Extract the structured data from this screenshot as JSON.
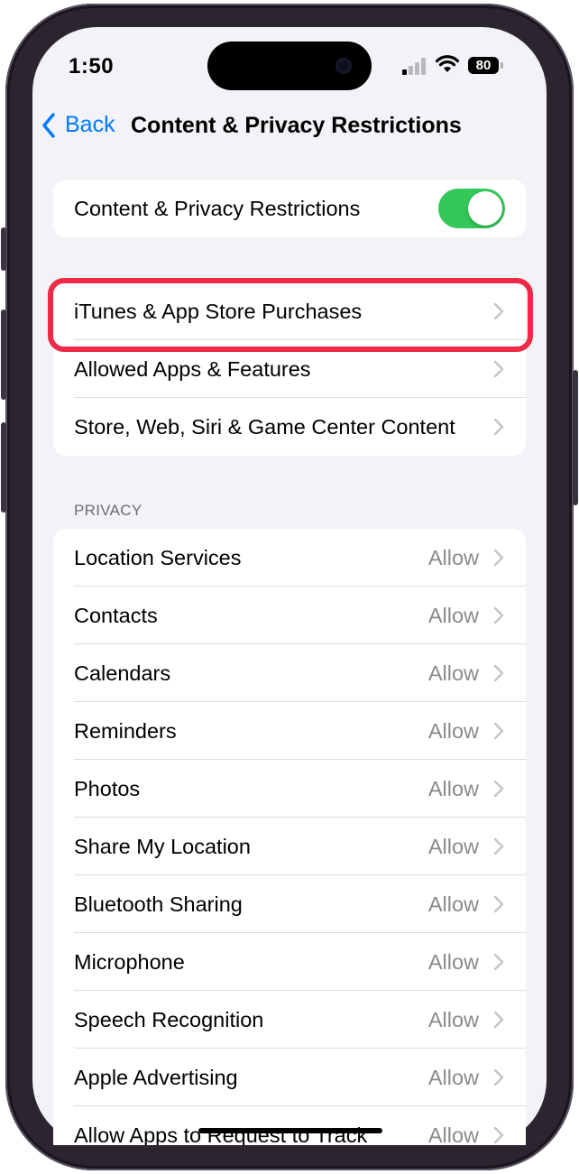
{
  "status": {
    "time": "1:50",
    "battery": "80"
  },
  "nav": {
    "back_label": "Back",
    "title": "Content & Privacy Restrictions"
  },
  "master_toggle": {
    "label": "Content & Privacy Restrictions",
    "on": true,
    "color": "#34c759"
  },
  "main_items": [
    {
      "label": "iTunes & App Store Purchases"
    },
    {
      "label": "Allowed Apps & Features"
    },
    {
      "label": "Store, Web, Siri & Game Center Content"
    }
  ],
  "privacy": {
    "header": "PRIVACY",
    "items": [
      {
        "label": "Location Services",
        "value": "Allow"
      },
      {
        "label": "Contacts",
        "value": "Allow"
      },
      {
        "label": "Calendars",
        "value": "Allow"
      },
      {
        "label": "Reminders",
        "value": "Allow"
      },
      {
        "label": "Photos",
        "value": "Allow"
      },
      {
        "label": "Share My Location",
        "value": "Allow"
      },
      {
        "label": "Bluetooth Sharing",
        "value": "Allow"
      },
      {
        "label": "Microphone",
        "value": "Allow"
      },
      {
        "label": "Speech Recognition",
        "value": "Allow"
      },
      {
        "label": "Apple Advertising",
        "value": "Allow"
      },
      {
        "label": "Allow Apps to Request to Track",
        "value": "Allow"
      }
    ]
  },
  "colors": {
    "accent": "#007aff",
    "highlight": "#ee2a47",
    "background": "#f2f2f7"
  }
}
